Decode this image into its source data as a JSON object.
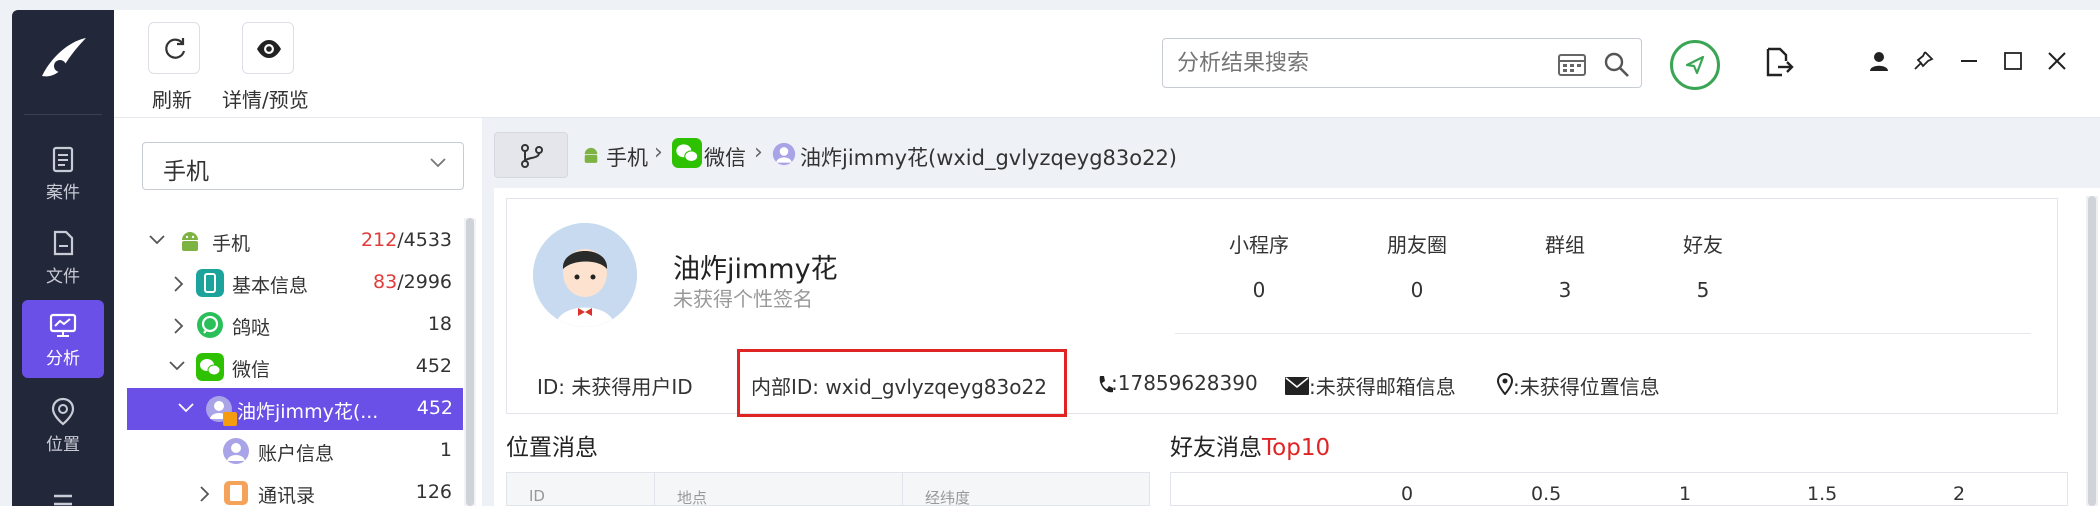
{
  "rail": {
    "items": [
      {
        "label": "案件",
        "icon": "clipboard-icon"
      },
      {
        "label": "文件",
        "icon": "file-icon"
      },
      {
        "label": "分析",
        "icon": "analysis-monitor-icon",
        "active": true
      },
      {
        "label": "位置",
        "icon": "location-pin-icon"
      }
    ]
  },
  "toolbar": {
    "refresh_label": "刷新",
    "details_label": "详情/预览",
    "search_placeholder": "分析结果搜索"
  },
  "tree": {
    "select_value": "手机",
    "rows": [
      {
        "label": "手机",
        "count_red": "212",
        "count_rest": "/4533",
        "icon": "android-icon"
      },
      {
        "label": "基本信息",
        "count_red": "83",
        "count_rest": "/2996",
        "icon": "phone-info-icon"
      },
      {
        "label": "鸽哒",
        "count": "18",
        "icon": "gedda-icon"
      },
      {
        "label": "微信",
        "count": "452",
        "icon": "wechat-icon"
      },
      {
        "label": "油炸jimmy花(...",
        "count": "452",
        "icon": "user-avatar-icon",
        "selected": true
      },
      {
        "label": "账户信息",
        "count": "1",
        "icon": "account-icon"
      },
      {
        "label": "通讯录",
        "count": "126",
        "icon": "contacts-icon"
      }
    ]
  },
  "breadcrumb": {
    "items": [
      "手机",
      "微信",
      "油炸jimmy花(wxid_gvlyzqeyg83o22)"
    ]
  },
  "profile": {
    "name": "油炸jimmy花",
    "signature": "未获得个性签名",
    "stats": [
      {
        "label": "小程序",
        "value": "0"
      },
      {
        "label": "朋友圈",
        "value": "0"
      },
      {
        "label": "群组",
        "value": "3"
      },
      {
        "label": "好友",
        "value": "5"
      }
    ],
    "id_text": "ID: 未获得用户ID",
    "internal_id_text": "内部ID: wxid_gvlyzqeyg83o22",
    "phone_text": ":17859628390",
    "email_text": ":未获得邮箱信息",
    "location_text": ":未获得位置信息"
  },
  "sections": {
    "location_title": "位置消息",
    "friends_title_main": "好友消息",
    "friends_title_accent": "Top10",
    "location_cols": [
      "ID",
      "地点",
      "经纬度"
    ],
    "axis_ticks": [
      "0",
      "0.5",
      "1",
      "1.5",
      "2"
    ]
  },
  "colors": {
    "rail_bg": "#23273a",
    "accent": "#6a50e6",
    "highlight_red": "#e02424",
    "green": "#3aa655"
  }
}
